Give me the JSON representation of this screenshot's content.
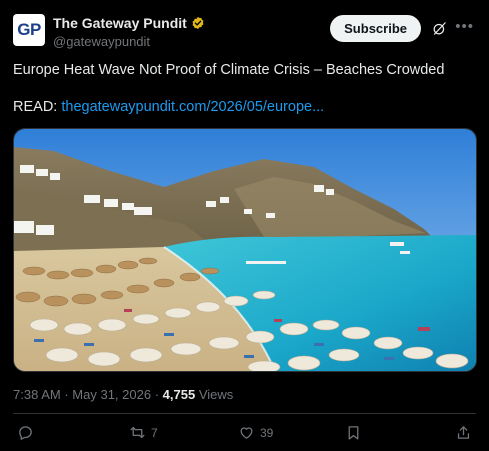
{
  "account": {
    "avatar_text": "GP",
    "display_name": "The Gateway Pundit",
    "handle": "@gatewaypundit",
    "verified_color": "#e2b719"
  },
  "header": {
    "subscribe_label": "Subscribe",
    "grok_icon": "grok-icon",
    "more_icon": "more-icon"
  },
  "tweet": {
    "headline": "Europe Heat Wave Not Proof of Climate Crisis – Beaches Crowded",
    "read_label": "READ:",
    "link_text": "thegatewaypundit.com/2026/05/europe..."
  },
  "media": {
    "kind": "photo",
    "subject": "crowded beach with umbrellas, turquoise sea and rocky hillside"
  },
  "meta": {
    "time": "7:38 AM",
    "separator": "·",
    "date": "May 31, 2026",
    "views_count": "4,755",
    "views_label": "Views"
  },
  "actions": {
    "reply_count": "",
    "repost_count": "7",
    "like_count": "39"
  },
  "colors": {
    "background": "#000000",
    "text": "#e7e9ea",
    "muted": "#71767b",
    "link": "#1d9bf0",
    "divider": "#2f3336"
  }
}
